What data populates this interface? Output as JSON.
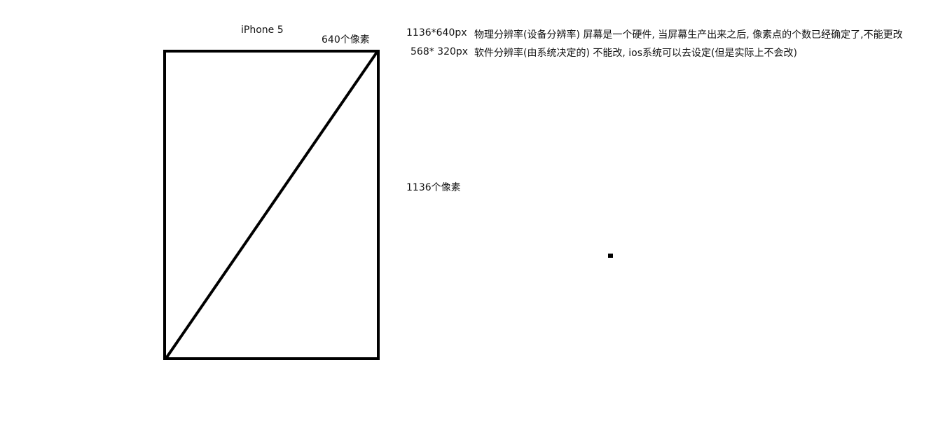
{
  "labels": {
    "device_title": "iPhone 5",
    "width_pixels": "640个像素",
    "height_pixels": "1136个像素",
    "physical_resolution": "1136*640px",
    "physical_description": "物理分辨率(设备分辨率)  屏幕是一个硬件, 当屏幕生产出来之后, 像素点的个数已经确定了,不能更改",
    "software_resolution": "568* 320px",
    "software_description": "软件分辨率(由系统决定的) 不能改, ios系统可以去设定(但是实际上不会改)"
  },
  "colors": {
    "stroke": "#000000",
    "text": "#111111",
    "background": "#ffffff"
  }
}
